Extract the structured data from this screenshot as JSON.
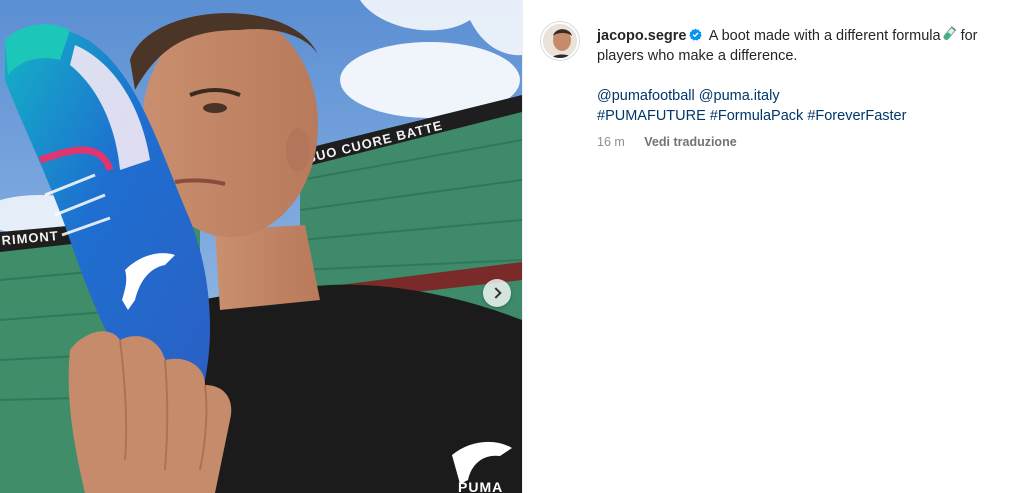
{
  "post": {
    "username": "jacopo.segre",
    "caption_line1": "A boot made with a different formula",
    "caption_line2": "for players who make a difference.",
    "mentions": [
      "@pumafootball",
      "@puma.italy"
    ],
    "hashtags": [
      "#PUMAFUTURE",
      "#FormulaPack",
      "#ForeverFaster"
    ],
    "time_ago": "16 m",
    "translate_label": "Vedi traduzione"
  },
  "photo": {
    "stadium_banner": "SUO CUORE BATTE",
    "stadium_banner_left": "RIMONT",
    "shirt_brand": "PUMA",
    "boot_brand_mark": "puma-cat-logo"
  },
  "colors": {
    "link": "#00376b",
    "text": "#262626",
    "muted": "#8e8e8e",
    "verified": "#0095f6",
    "boot_blue": "#1e6fd0"
  },
  "icons": {
    "verified": "verified-badge-icon",
    "emoji": "test-tube-emoji-icon",
    "next": "chevron-right-icon"
  }
}
